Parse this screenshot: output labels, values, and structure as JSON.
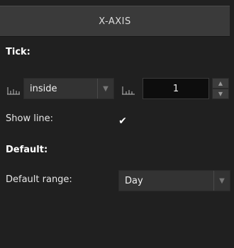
{
  "header": {
    "title": "X-AXIS"
  },
  "tick": {
    "section_title": "Tick:",
    "position_icon": "tick-position-icon",
    "position_value": "inside",
    "length_icon": "tick-length-icon",
    "length_value": "1"
  },
  "show_line": {
    "label": "Show line:",
    "checked": true,
    "check_glyph": "✔"
  },
  "default": {
    "section_title": "Default:",
    "range_label": "Default range:",
    "range_value": "Day"
  },
  "colors": {
    "background": "#202020",
    "header_bg": "#3a3a3a",
    "input_bg": "#333333"
  }
}
